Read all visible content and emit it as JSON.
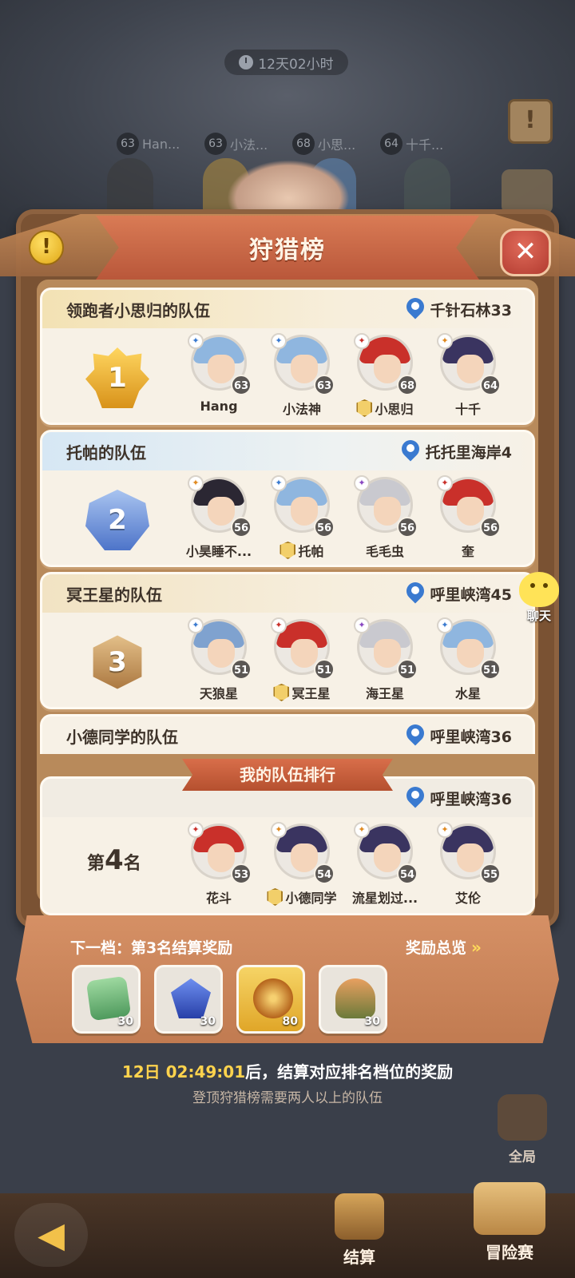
{
  "top": {
    "timer": "12天02小时",
    "podium": [
      {
        "level": "63",
        "name": "Han..."
      },
      {
        "level": "63",
        "name": "小法..."
      },
      {
        "level": "68",
        "name": "小思..."
      },
      {
        "level": "64",
        "name": "十千..."
      }
    ]
  },
  "header": {
    "title": "狩猎榜"
  },
  "teams": [
    {
      "rank": "1",
      "name": "领跑者小思归的队伍",
      "location": "千针石林33",
      "members": [
        {
          "name": "Hang",
          "level": "63",
          "leader": false
        },
        {
          "name": "小法神",
          "level": "63",
          "leader": false
        },
        {
          "name": "小思归",
          "level": "68",
          "leader": true
        },
        {
          "name": "十千",
          "level": "64",
          "leader": false
        }
      ]
    },
    {
      "rank": "2",
      "name": "托帕的队伍",
      "location": "托托里海岸4",
      "members": [
        {
          "name": "小昊睡不...",
          "level": "56",
          "leader": false
        },
        {
          "name": "托帕",
          "level": "56",
          "leader": true
        },
        {
          "name": "毛毛虫",
          "level": "56",
          "leader": false
        },
        {
          "name": "奎",
          "level": "56",
          "leader": false
        }
      ]
    },
    {
      "rank": "3",
      "name": "冥王星的队伍",
      "location": "呼里峡湾45",
      "members": [
        {
          "name": "天狼星",
          "level": "51",
          "leader": false
        },
        {
          "name": "冥王星",
          "level": "51",
          "leader": true
        },
        {
          "name": "海王星",
          "level": "51",
          "leader": false
        },
        {
          "name": "水星",
          "level": "51",
          "leader": false
        }
      ]
    },
    {
      "rank": "",
      "name": "小德同学的队伍",
      "location": "呼里峡湾36",
      "members": []
    }
  ],
  "my_team": {
    "label": "我的队伍排行",
    "location": "呼里峡湾36",
    "rank_prefix": "第",
    "rank": "4",
    "rank_suffix": "名",
    "members": [
      {
        "name": "花斗",
        "level": "53",
        "leader": false
      },
      {
        "name": "小德同学",
        "level": "54",
        "leader": true
      },
      {
        "name": "流星划过...",
        "level": "54",
        "leader": false
      },
      {
        "name": "艾伦",
        "level": "55",
        "leader": false
      }
    ]
  },
  "rewards": {
    "next_tier": "下一档：第3名结算奖励",
    "overview": "奖励总览",
    "items": [
      {
        "icon": "green-ticket-icon",
        "count": "30"
      },
      {
        "icon": "blue-crystal-icon",
        "count": "30"
      },
      {
        "icon": "gold-orb-icon",
        "count": "80"
      },
      {
        "icon": "meal-plate-icon",
        "count": "30"
      }
    ]
  },
  "footer": {
    "countdown_time": "12日 02:49:01",
    "countdown_text": "后，结算对应排名档位的奖励",
    "hint": "登顶狩猎榜需要两人以上的队伍"
  },
  "chat": {
    "label": "聊天"
  },
  "nav": {
    "global": "全局",
    "settle": "结算",
    "adventure": "冒险赛"
  },
  "colors": {
    "accent": "#ffd34d",
    "ribbon": "#c8603d",
    "card": "#f7f1e6",
    "pin": "#3a7ad0"
  }
}
